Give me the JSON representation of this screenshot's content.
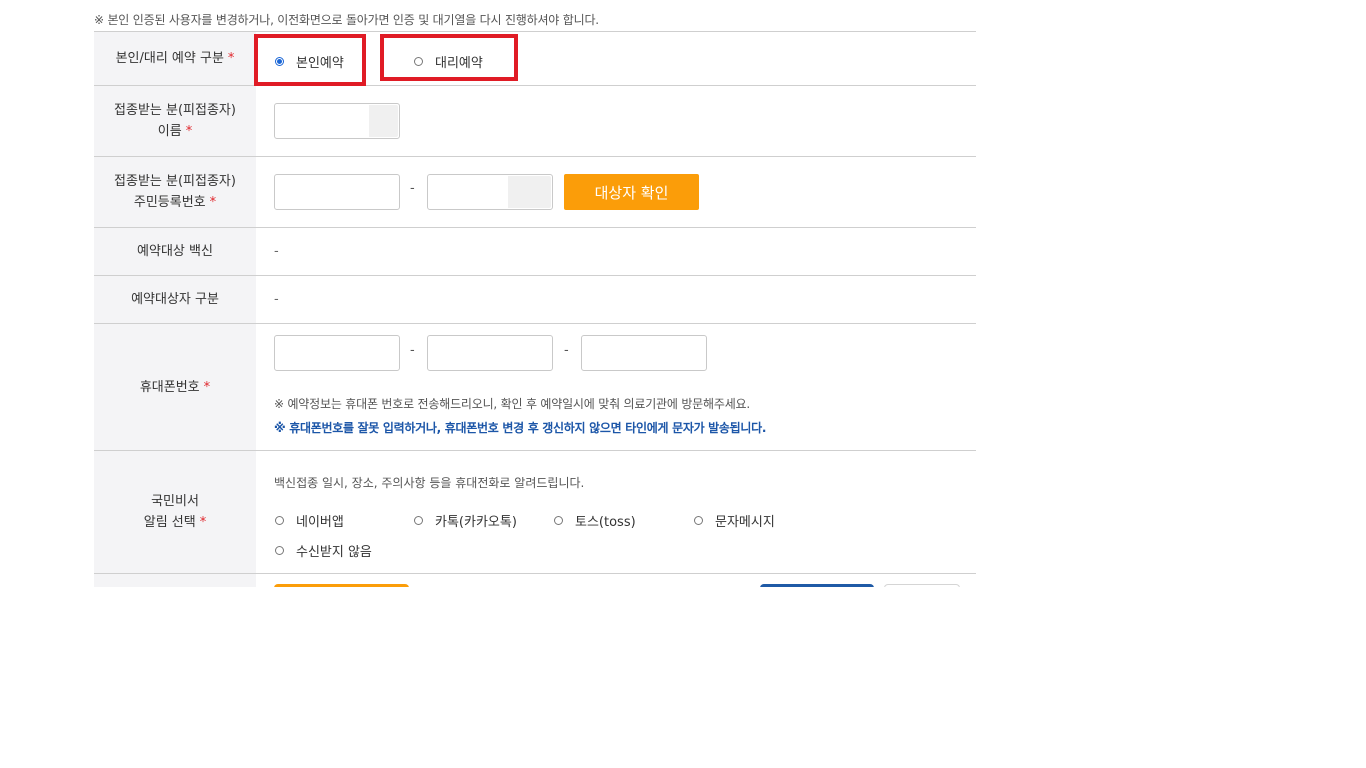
{
  "top_notice": "※ 본인 인증된 사용자를 변경하거나, 이전화면으로 돌아가면 인증 및 대기열을 다시 진행하셔야 합니다.",
  "rows": {
    "reservation_type": {
      "label": "본인/대리 예약 구분",
      "required_mark": "*",
      "options": [
        {
          "label": "본인예약",
          "checked": true
        },
        {
          "label": "대리예약",
          "checked": false
        }
      ]
    },
    "name": {
      "label_line1": "접종받는 분(피접종자)",
      "label_line2": "이름",
      "required_mark": "*"
    },
    "resident_number": {
      "label_line1": "접종받는 분(피접종자)",
      "label_line2": "주민등록번호",
      "required_mark": "*",
      "separator": "-",
      "confirm_button": "대상자 확인"
    },
    "vaccine": {
      "label": "예약대상 백신",
      "value": "-"
    },
    "target_type": {
      "label": "예약대상자 구분",
      "value": "-"
    },
    "phone": {
      "label": "휴대폰번호",
      "required_mark": "*",
      "separator1": "-",
      "separator2": "-",
      "info": "※ 예약정보는 휴대폰 번호로 전송해드리오니, 확인 후 예약일시에 맞춰 의료기관에 방문해주세요.",
      "warning": "※ 휴대폰번호를 잘못 입력하거나, 휴대폰번호 변경 후 갱신하지 않으면 타인에게 문자가 발송됩니다."
    },
    "notification": {
      "label_line1": "국민비서",
      "label_line2": "알림 선택",
      "required_mark": "*",
      "note": "백신접종 일시, 장소, 주의사항 등을 휴대전화로 알려드립니다.",
      "options": [
        {
          "label": "네이버앱",
          "checked": false
        },
        {
          "label": "카톡(카카오톡)",
          "checked": false
        },
        {
          "label": "토스(toss)",
          "checked": false
        },
        {
          "label": "문자메시지",
          "checked": false
        },
        {
          "label": "수신받지 않음",
          "checked": false
        }
      ]
    }
  },
  "colors": {
    "accent_orange": "#fb9d09",
    "highlight_red": "#e01b25",
    "warning_blue": "#1c56a8",
    "required_red": "#e0262c",
    "label_bg": "#f4f4f6",
    "bottom_blue_button": "#1f5aa6"
  }
}
